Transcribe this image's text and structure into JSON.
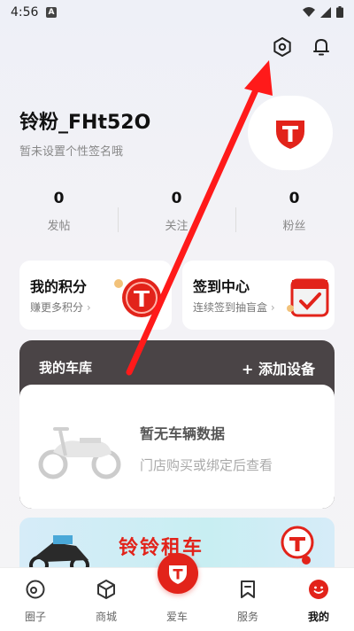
{
  "status_bar": {
    "time": "4:56",
    "notif_letter": "A"
  },
  "header": {
    "settings_icon": "gear-icon",
    "bell_icon": "bell-icon"
  },
  "profile": {
    "name": "铃粉_FHt52O",
    "signature": "暂未设置个性签名哦"
  },
  "stats": [
    {
      "value": "0",
      "label": "发帖"
    },
    {
      "value": "0",
      "label": "关注"
    },
    {
      "value": "0",
      "label": "粉丝"
    }
  ],
  "cards": {
    "points": {
      "title": "我的积分",
      "subtitle": "赚更多积分"
    },
    "checkin": {
      "title": "签到中心",
      "subtitle": "连续签到抽盲盒"
    }
  },
  "garage": {
    "title": "我的车库",
    "add_label": "+ 添加设备",
    "empty_title": "暂无车辆数据",
    "empty_subtitle": "门店购买或绑定后查看"
  },
  "banner": {
    "title": "铃铃租车"
  },
  "bottom_nav": [
    {
      "label": "圈子",
      "icon": "circle-target-icon"
    },
    {
      "label": "商城",
      "icon": "cube-icon"
    },
    {
      "label": "爱车",
      "icon": "brand-shield-icon"
    },
    {
      "label": "服务",
      "icon": "bookmark-icon"
    },
    {
      "label": "我的",
      "icon": "smile-face-icon"
    }
  ],
  "colors": {
    "brand_red": "#e2231a",
    "garage_header": "#4a4446"
  }
}
